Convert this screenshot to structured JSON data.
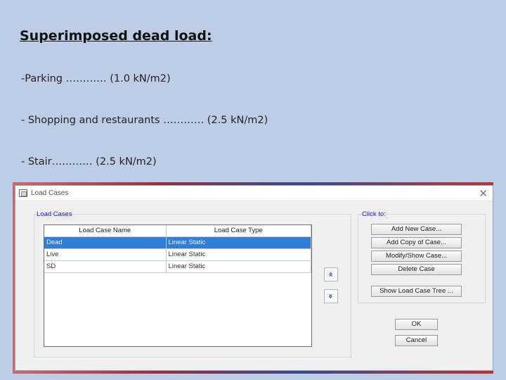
{
  "slide": {
    "title": "Superimposed dead load:",
    "bullets": [
      "-Parking ………… (1.0 kN/m2)",
      "- Shopping and restaurants ………… (2.5 kN/m2)",
      "- Stair………… (2.5 kN/m2)"
    ]
  },
  "dialog": {
    "title": "Load Cases",
    "close_glyph": "✕",
    "load_cases_group": "Load Cases",
    "columns": [
      "Load Case Name",
      "Load Case Type"
    ],
    "rows": [
      {
        "name": "Dead",
        "type": "Linear Static",
        "selected": true
      },
      {
        "name": "Live",
        "type": "Linear Static",
        "selected": false
      },
      {
        "name": "SD",
        "type": "Linear Static",
        "selected": false
      }
    ],
    "move_up_glyph": "«",
    "move_down_glyph": "«",
    "click_to_label": "Click to:",
    "buttons": {
      "add_new": "Add New Case...",
      "add_copy": "Add Copy of Case...",
      "modify_show": "Modify/Show Case...",
      "delete": "Delete Case",
      "show_tree": "Show Load Case Tree ...",
      "ok": "OK",
      "cancel": "Cancel"
    }
  }
}
